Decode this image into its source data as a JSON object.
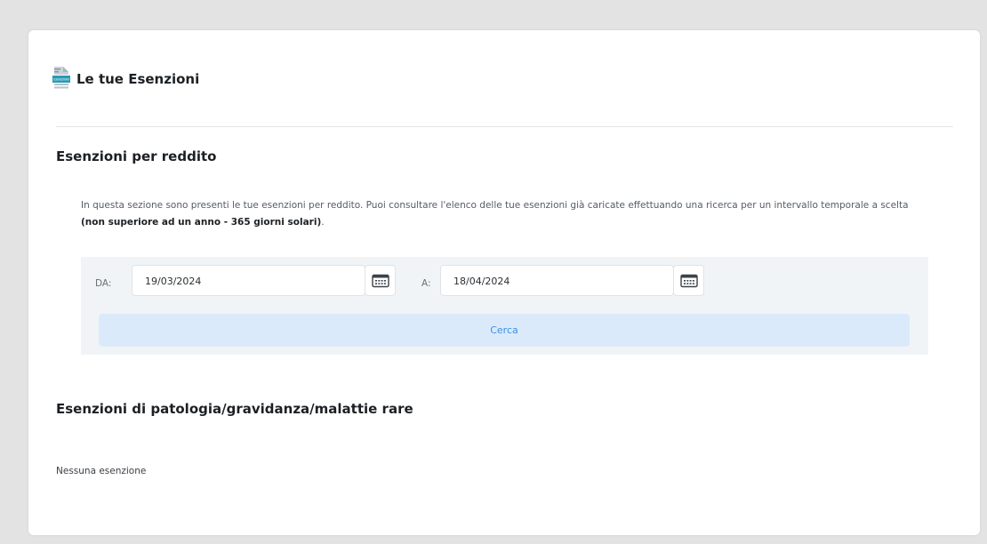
{
  "header": {
    "title": "Le tue Esenzioni",
    "icon": "exemption-document-icon",
    "icon_text": "ESENZIONI"
  },
  "income_section": {
    "title": "Esenzioni per reddito",
    "description": "In questa sezione sono presenti le tue esenzioni per reddito. Puoi consultare l'elenco delle tue esenzioni già caricate effettuando una ricerca per un intervallo temporale a scelta",
    "description_bold": "(non superiore ad un anno - 365 giorni solari)",
    "description_end": ".",
    "from_label": "DA:",
    "from_value": "19/03/2024",
    "to_label": "A:",
    "to_value": "18/04/2024",
    "search_label": "Cerca"
  },
  "pathology_section": {
    "title": "Esenzioni di patologia/gravidanza/malattie rare",
    "empty_text": "Nessuna esenzione"
  },
  "colors": {
    "page_bg": "#e3e3e3",
    "panel_bg": "#f1f4f7",
    "button_bg": "#dbeafb",
    "button_text": "#3e8fe3",
    "icon_accent": "#2a9ab4"
  }
}
